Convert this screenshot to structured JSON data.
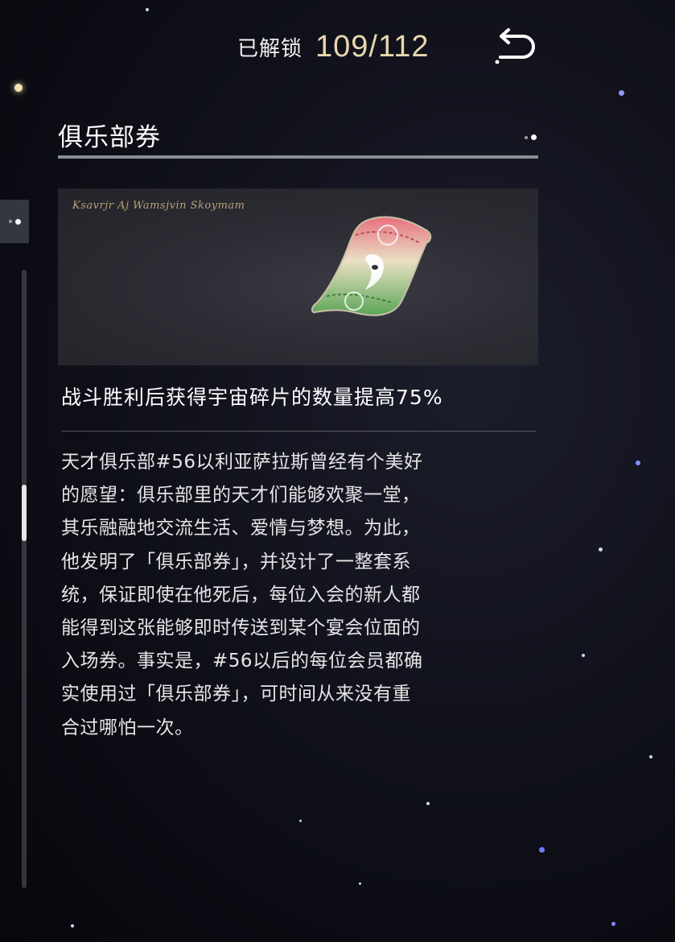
{
  "header": {
    "unlock_label": "已解锁",
    "unlock_count": "109/112",
    "back_icon": "return-arrow-icon"
  },
  "item": {
    "title": "俱乐部券",
    "banner_script": "Ksavrjr Aj Wamsjvin Skoymam",
    "effect": "战斗胜利后获得宇宙碎片的数量提高75%",
    "description": "天才俱乐部#56以利亚萨拉斯曾经有个美好\n的愿望：俱乐部里的天才们能够欢聚一堂，\n其乐融融地交流生活、爱情与梦想。为此，\n他发明了「俱乐部券」，并设计了一整套系\n统，保证即使在他死后，每位入会的新人都\n能得到这张能够即时传送到某个宴会位面的\n入场券。事实是，#56以后的每位会员都确\n实使用过「俱乐部券」，可时间从来没有重\n合过哪怕一次。"
  },
  "colors": {
    "count_gold": "#e8d7ad",
    "ticket_red": "#e06a78",
    "ticket_green": "#5fa85a"
  }
}
